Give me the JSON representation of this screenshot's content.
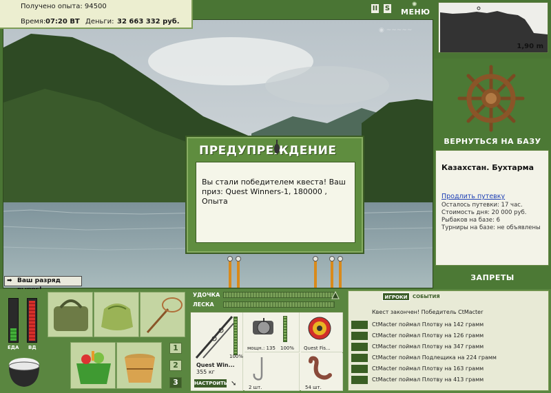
{
  "header": {
    "exp_text": "Получено опыта: 94500",
    "time_label": "Время:",
    "time_value": "07:20 ВТ",
    "money_label": "Деньги:",
    "money_value": "32 663 332 руб."
  },
  "top_buttons": {
    "pause": "II",
    "sound": "S",
    "menu": "МЕНЮ"
  },
  "depth": {
    "value": "1,90 m"
  },
  "dialog": {
    "title": "ПРЕДУПРЕЖДЕНИЕ",
    "message": "Вы стали победителем квеста! Ваш приз: Quest Winners-1, 180000 , Опыта"
  },
  "rank_message": "Ваш разряд вырос!",
  "right_panel": {
    "return_label": "ВЕРНУТЬСЯ НА БАЗУ",
    "base_name": "Казахстан. Бухтарма",
    "extend_link": "Продлить путевку",
    "time_left": "Осталось путевки: 17 час.",
    "day_cost": "Стоимость дня: 20 000 руб.",
    "fishers": "Рыбаков на базе: 6",
    "tournaments": "Турниры на базе: не объявлены",
    "bans_label": "ЗАПРЕТЫ"
  },
  "meters": {
    "food_label": "ЕДА",
    "exp_label": "ВД",
    "food_level": 0.3,
    "exp_level": 0.95
  },
  "slot_numbers": [
    "1",
    "2",
    "3"
  ],
  "bars": {
    "rod_label": "УДОЧКА",
    "line_label": "ЛЕСКА"
  },
  "tackle": {
    "rod_percent": "100%",
    "rod_name": "Quest Win...",
    "rod_weight": "355 кг",
    "setup_button": "НАСТРОИТЬ",
    "reel_power": "мощн.: 135",
    "reel_percent": "100%",
    "line_name": "Quest Fis...",
    "hook_count": "2 шт.",
    "bait_count": "54 шт."
  },
  "events": {
    "tab_players": "ИГРОКИ",
    "tab_events": "СОБЫТИЯ",
    "quest_message": "Квест закончен! Победитель CtMacter",
    "rows": [
      "CtMacter поймал Плотву на 142 грамм",
      "CtMacter поймал Плотву на 126 грамм",
      "CtMacter поймал Плотву на 347 грамм",
      "CtMacter поймал Подлещика на 224 грамм",
      "CtMacter поймал Плотву на 163 грамм",
      "CtMacter поймал Плотву на 413 грамм"
    ]
  }
}
